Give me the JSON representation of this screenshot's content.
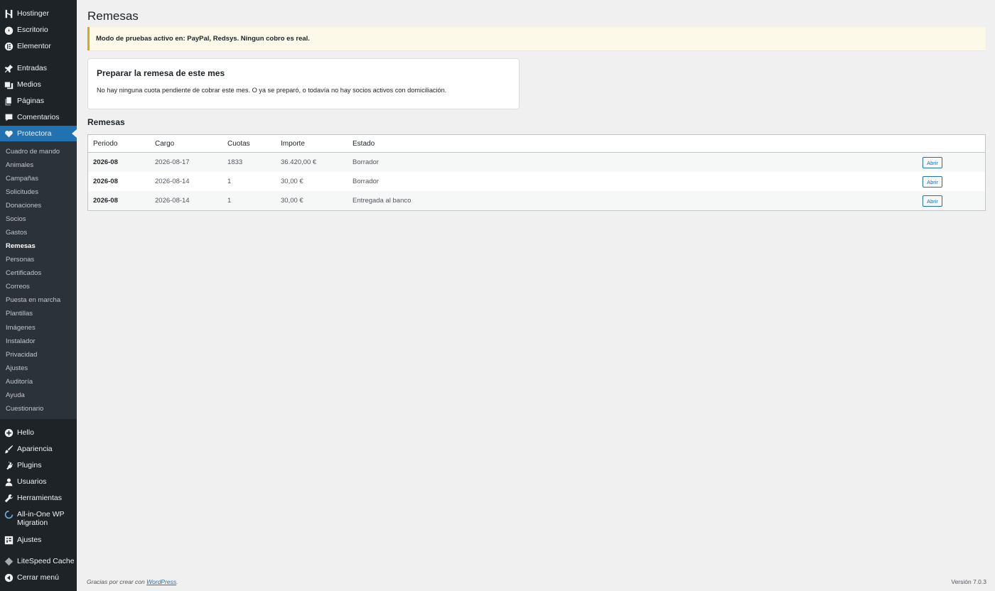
{
  "sidebar": {
    "top_items": [
      {
        "label": "Hostinger",
        "icon": "hostinger-icon"
      },
      {
        "label": "Escritorio",
        "icon": "dashboard-icon"
      },
      {
        "label": "Elementor",
        "icon": "elementor-icon"
      },
      {
        "label": "Entradas",
        "icon": "pin-icon"
      },
      {
        "label": "Medios",
        "icon": "media-icon"
      },
      {
        "label": "Páginas",
        "icon": "page-icon"
      },
      {
        "label": "Comentarios",
        "icon": "comment-icon"
      },
      {
        "label": "Protectora",
        "icon": "heart-icon"
      }
    ],
    "submenu": [
      "Cuadro de mando",
      "Animales",
      "Campañas",
      "Solicitudes",
      "Donaciones",
      "Socios",
      "Gastos",
      "Remesas",
      "Personas",
      "Certificados",
      "Correos",
      "Puesta en marcha",
      "Plantillas",
      "Imágenes",
      "Instalador",
      "Privacidad",
      "Ajustes",
      "Auditoría",
      "Ayuda",
      "Cuestionario"
    ],
    "bottom_items": [
      {
        "label": "Hello",
        "icon": "plus-circle-icon"
      },
      {
        "label": "Apariencia",
        "icon": "brush-icon"
      },
      {
        "label": "Plugins",
        "icon": "plugin-icon"
      },
      {
        "label": "Usuarios",
        "icon": "user-icon"
      },
      {
        "label": "Herramientas",
        "icon": "wrench-icon"
      },
      {
        "label": "All-in-One WP Migration",
        "icon": "migration-icon"
      },
      {
        "label": "Ajustes",
        "icon": "settings-icon"
      },
      {
        "label": "LiteSpeed Cache",
        "icon": "diamond-icon"
      },
      {
        "label": "Cerrar menú",
        "icon": "collapse-icon"
      }
    ]
  },
  "page": {
    "title": "Remesas",
    "notice": "Modo de pruebas activo en: PayPal, Redsys. Ningun cobro es real.",
    "card_title": "Preparar la remesa de este mes",
    "card_text": "No hay ninguna cuota pendiente de cobrar este mes. O ya se preparó, o todavía no hay socios activos con domiciliación.",
    "section_title": "Remesas"
  },
  "table": {
    "headers": [
      "Periodo",
      "Cargo",
      "Cuotas",
      "Importe",
      "Estado"
    ],
    "rows": [
      {
        "periodo": "2026-08",
        "cargo": "2026-08-17",
        "cuotas": "1833",
        "importe": "36.420,00 €",
        "estado": "Borrador",
        "action": "Abrir"
      },
      {
        "periodo": "2026-08",
        "cargo": "2026-08-14",
        "cuotas": "1",
        "importe": "30,00 €",
        "estado": "Borrador",
        "action": "Abrir"
      },
      {
        "periodo": "2026-08",
        "cargo": "2026-08-14",
        "cuotas": "1",
        "importe": "30,00 €",
        "estado": "Entregada al banco",
        "action": "Abrir"
      }
    ]
  },
  "footer": {
    "text": "Gracias por crear con",
    "link": "WordPress",
    "period": ".",
    "version": "Versión 7.0.3"
  },
  "colors": {
    "sidebar": "#1d2327",
    "accent": "#2271b1",
    "notice_border": "#dba617"
  }
}
